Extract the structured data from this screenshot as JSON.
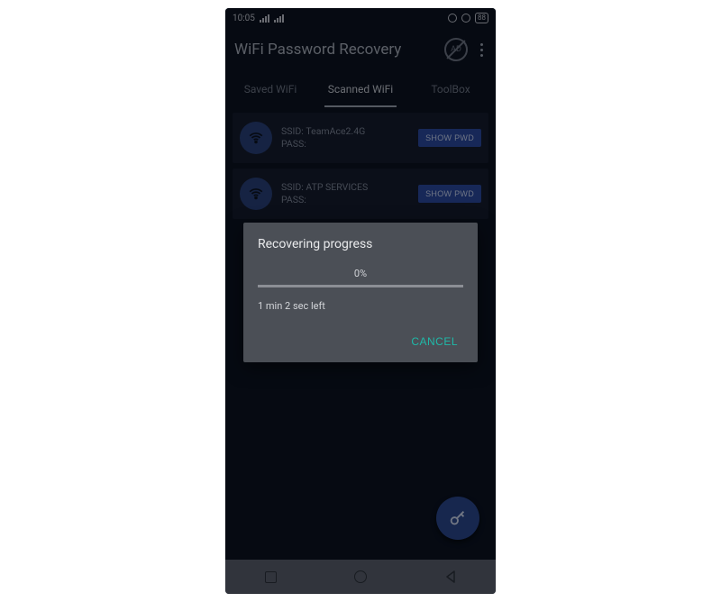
{
  "statusbar": {
    "time": "10:05",
    "battery": "88"
  },
  "appbar": {
    "title": "WiFi Password Recovery",
    "ad_label": "AD"
  },
  "tabs": {
    "saved": "Saved WiFi",
    "scanned": "Scanned WiFi",
    "toolbox": "ToolBox"
  },
  "networks": [
    {
      "ssid_label": "SSID:",
      "ssid": "TeamAce2.4G",
      "pass_label": "PASS:",
      "btn": "SHOW PWD"
    },
    {
      "ssid_label": "SSID:",
      "ssid": "ATP SERVICES",
      "pass_label": "PASS:",
      "btn": "SHOW PWD"
    }
  ],
  "dialog": {
    "title": "Recovering progress",
    "percent": "0%",
    "time_left": "1 min 2 sec left",
    "cancel": "CANCEL"
  }
}
